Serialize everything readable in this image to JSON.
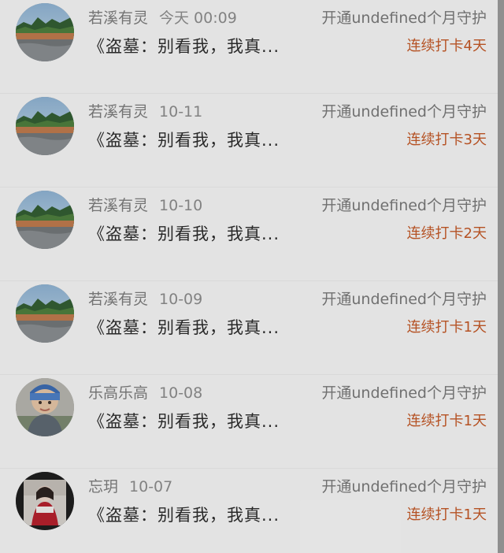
{
  "rows": [
    {
      "name": "若溪有灵",
      "date": "今天 00:09",
      "action": "开通undefined个月守护",
      "title": "《盗墓：别看我，我真...",
      "badge": "连续打卡4天"
    },
    {
      "name": "若溪有灵",
      "date": "10-11",
      "action": "开通undefined个月守护",
      "title": "《盗墓：别看我，我真...",
      "badge": "连续打卡3天"
    },
    {
      "name": "若溪有灵",
      "date": "10-10",
      "action": "开通undefined个月守护",
      "title": "《盗墓：别看我，我真...",
      "badge": "连续打卡2天"
    },
    {
      "name": "若溪有灵",
      "date": "10-09",
      "action": "开通undefined个月守护",
      "title": "《盗墓：别看我，我真...",
      "badge": "连续打卡1天"
    },
    {
      "name": "乐高乐高",
      "date": "10-08",
      "action": "开通undefined个月守护",
      "title": "《盗墓：别看我，我真...",
      "badge": "连续打卡1天"
    },
    {
      "name": "忘玥",
      "date": "10-07",
      "action": "开通undefined个月守护",
      "title": "《盗墓：别看我，我真...",
      "badge": "连续打卡1天"
    }
  ],
  "colors": {
    "badge": "#c55a28",
    "meta": "#7d7d7d",
    "title": "#2d2d2d",
    "background": "#f7f7f7"
  },
  "icons": {
    "avatar_1": "landscape-avatar-icon",
    "avatar_2": "child-avatar-icon",
    "avatar_3": "girl-avatar-icon"
  }
}
